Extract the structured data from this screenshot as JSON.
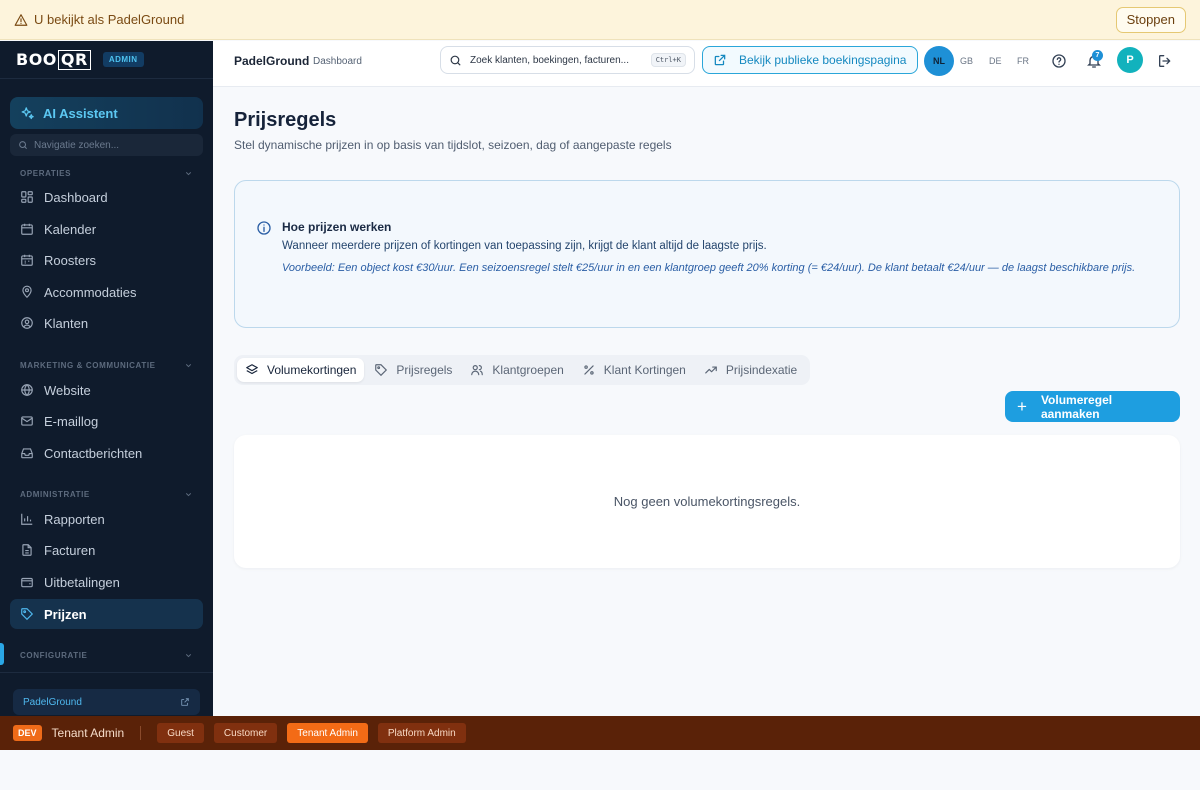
{
  "impersonation": {
    "text": "U bekijkt als PadelGround",
    "stop_label": "Stoppen"
  },
  "sidebar": {
    "logo_text": "BOO",
    "logo_box": "QR",
    "admin_badge": "ADMIN",
    "ai_label": "AI Assistent",
    "search_placeholder": "Navigatie zoeken...",
    "sections": [
      {
        "label": "OPERATIES",
        "items": [
          "Dashboard",
          "Kalender",
          "Roosters",
          "Accommodaties",
          "Klanten"
        ]
      },
      {
        "label": "MARKETING & COMMUNICATIE",
        "items": [
          "Website",
          "E-maillog",
          "Contactberichten"
        ]
      },
      {
        "label": "ADMINISTRATIE",
        "items": [
          "Rapporten",
          "Facturen",
          "Uitbetalingen",
          "Prijzen"
        ]
      },
      {
        "label": "CONFIGURATIE",
        "items": []
      }
    ],
    "active_item": "Prijzen",
    "tenant_name": "PadelGround"
  },
  "header": {
    "org": "PadelGround",
    "page": "Dashboard",
    "search_placeholder": "Zoek klanten, boekingen, facturen...",
    "search_shortcut": "Ctrl+K",
    "public_button": "Bekijk publieke boekingspagina",
    "languages": [
      "NL",
      "GB",
      "DE",
      "FR"
    ],
    "active_language": "NL",
    "notification_count": "7",
    "avatar_initial": "P"
  },
  "main": {
    "title": "Prijsregels",
    "subtitle": "Stel dynamische prijzen in op basis van tijdslot, seizoen, dag of aangepaste regels",
    "info": {
      "title": "Hoe prijzen werken",
      "line": "Wanneer meerdere prijzen of kortingen van toepassing zijn, krijgt de klant altijd de laagste prijs.",
      "example": "Voorbeeld: Een object kost €30/uur. Een seizoensregel stelt €25/uur in en een klantgroep geeft 20% korting (= €24/uur). De klant betaalt €24/uur — de laagst beschikbare prijs."
    },
    "tabs": [
      "Volumekortingen",
      "Prijsregels",
      "Klantgroepen",
      "Klant Kortingen",
      "Prijsindexatie"
    ],
    "active_tab": "Volumekortingen",
    "create_button": "Volumeregel aanmaken",
    "empty_text": "Nog geen volumekortingsregels."
  },
  "devbar": {
    "tag": "DEV",
    "role": "Tenant Admin",
    "roles": [
      "Guest",
      "Customer",
      "Tenant Admin",
      "Platform Admin"
    ],
    "active_role": "Tenant Admin"
  },
  "colors": {
    "accent": "#1e9ee0",
    "sidebar_bg": "#0f1b2c",
    "devbar_bg": "#5a2208",
    "banner_bg": "#fdf4dc"
  }
}
